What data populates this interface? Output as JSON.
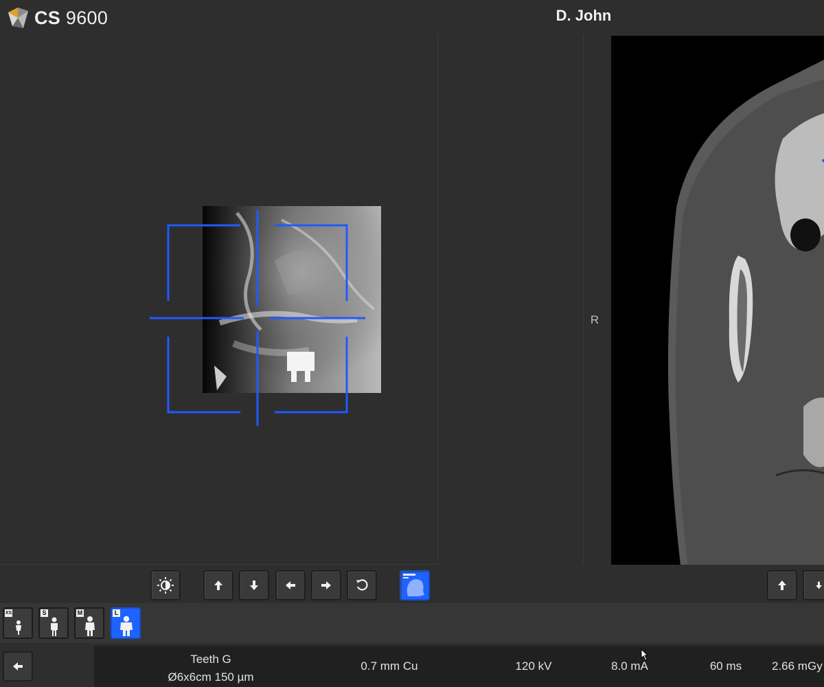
{
  "header": {
    "app_brand": "CS",
    "app_model": "9600",
    "patient_name": "D. John"
  },
  "views": {
    "orientation_label": "R"
  },
  "left_toolbar": {
    "buttons": [
      "brightness-icon",
      "arrow-up-icon",
      "arrow-down-icon",
      "arrow-left-icon",
      "arrow-right-icon",
      "reset-rotate-icon",
      "scout-view-icon"
    ]
  },
  "patient_size": {
    "options": [
      {
        "letter": "XS",
        "active": false
      },
      {
        "letter": "S",
        "active": false
      },
      {
        "letter": "M",
        "active": false
      },
      {
        "letter": "L",
        "active": true
      }
    ]
  },
  "parameters": {
    "program": "Teeth G",
    "fov": "Ø6x6cm 150 µm",
    "filter": "0.7 mm Cu",
    "voltage": "120 kV",
    "current": "8.0 mA",
    "time": "60 ms",
    "dose": "2.66 mGy"
  },
  "colors": {
    "accent": "#1e62ff",
    "background": "#2e2e2e",
    "params_bar": "#202020"
  }
}
